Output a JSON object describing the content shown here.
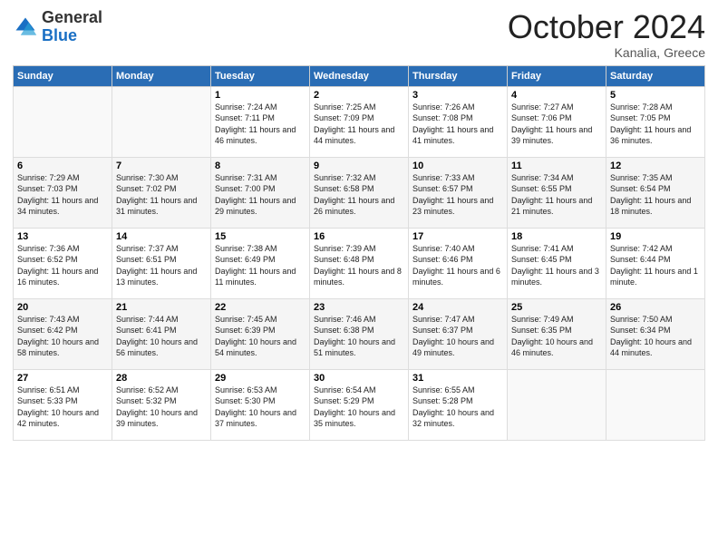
{
  "logo": {
    "general": "General",
    "blue": "Blue"
  },
  "header": {
    "month": "October 2024",
    "location": "Kanalia, Greece"
  },
  "weekdays": [
    "Sunday",
    "Monday",
    "Tuesday",
    "Wednesday",
    "Thursday",
    "Friday",
    "Saturday"
  ],
  "weeks": [
    [
      {
        "day": "",
        "sunrise": "",
        "sunset": "",
        "daylight": ""
      },
      {
        "day": "",
        "sunrise": "",
        "sunset": "",
        "daylight": ""
      },
      {
        "day": "1",
        "sunrise": "Sunrise: 7:24 AM",
        "sunset": "Sunset: 7:11 PM",
        "daylight": "Daylight: 11 hours and 46 minutes."
      },
      {
        "day": "2",
        "sunrise": "Sunrise: 7:25 AM",
        "sunset": "Sunset: 7:09 PM",
        "daylight": "Daylight: 11 hours and 44 minutes."
      },
      {
        "day": "3",
        "sunrise": "Sunrise: 7:26 AM",
        "sunset": "Sunset: 7:08 PM",
        "daylight": "Daylight: 11 hours and 41 minutes."
      },
      {
        "day": "4",
        "sunrise": "Sunrise: 7:27 AM",
        "sunset": "Sunset: 7:06 PM",
        "daylight": "Daylight: 11 hours and 39 minutes."
      },
      {
        "day": "5",
        "sunrise": "Sunrise: 7:28 AM",
        "sunset": "Sunset: 7:05 PM",
        "daylight": "Daylight: 11 hours and 36 minutes."
      }
    ],
    [
      {
        "day": "6",
        "sunrise": "Sunrise: 7:29 AM",
        "sunset": "Sunset: 7:03 PM",
        "daylight": "Daylight: 11 hours and 34 minutes."
      },
      {
        "day": "7",
        "sunrise": "Sunrise: 7:30 AM",
        "sunset": "Sunset: 7:02 PM",
        "daylight": "Daylight: 11 hours and 31 minutes."
      },
      {
        "day": "8",
        "sunrise": "Sunrise: 7:31 AM",
        "sunset": "Sunset: 7:00 PM",
        "daylight": "Daylight: 11 hours and 29 minutes."
      },
      {
        "day": "9",
        "sunrise": "Sunrise: 7:32 AM",
        "sunset": "Sunset: 6:58 PM",
        "daylight": "Daylight: 11 hours and 26 minutes."
      },
      {
        "day": "10",
        "sunrise": "Sunrise: 7:33 AM",
        "sunset": "Sunset: 6:57 PM",
        "daylight": "Daylight: 11 hours and 23 minutes."
      },
      {
        "day": "11",
        "sunrise": "Sunrise: 7:34 AM",
        "sunset": "Sunset: 6:55 PM",
        "daylight": "Daylight: 11 hours and 21 minutes."
      },
      {
        "day": "12",
        "sunrise": "Sunrise: 7:35 AM",
        "sunset": "Sunset: 6:54 PM",
        "daylight": "Daylight: 11 hours and 18 minutes."
      }
    ],
    [
      {
        "day": "13",
        "sunrise": "Sunrise: 7:36 AM",
        "sunset": "Sunset: 6:52 PM",
        "daylight": "Daylight: 11 hours and 16 minutes."
      },
      {
        "day": "14",
        "sunrise": "Sunrise: 7:37 AM",
        "sunset": "Sunset: 6:51 PM",
        "daylight": "Daylight: 11 hours and 13 minutes."
      },
      {
        "day": "15",
        "sunrise": "Sunrise: 7:38 AM",
        "sunset": "Sunset: 6:49 PM",
        "daylight": "Daylight: 11 hours and 11 minutes."
      },
      {
        "day": "16",
        "sunrise": "Sunrise: 7:39 AM",
        "sunset": "Sunset: 6:48 PM",
        "daylight": "Daylight: 11 hours and 8 minutes."
      },
      {
        "day": "17",
        "sunrise": "Sunrise: 7:40 AM",
        "sunset": "Sunset: 6:46 PM",
        "daylight": "Daylight: 11 hours and 6 minutes."
      },
      {
        "day": "18",
        "sunrise": "Sunrise: 7:41 AM",
        "sunset": "Sunset: 6:45 PM",
        "daylight": "Daylight: 11 hours and 3 minutes."
      },
      {
        "day": "19",
        "sunrise": "Sunrise: 7:42 AM",
        "sunset": "Sunset: 6:44 PM",
        "daylight": "Daylight: 11 hours and 1 minute."
      }
    ],
    [
      {
        "day": "20",
        "sunrise": "Sunrise: 7:43 AM",
        "sunset": "Sunset: 6:42 PM",
        "daylight": "Daylight: 10 hours and 58 minutes."
      },
      {
        "day": "21",
        "sunrise": "Sunrise: 7:44 AM",
        "sunset": "Sunset: 6:41 PM",
        "daylight": "Daylight: 10 hours and 56 minutes."
      },
      {
        "day": "22",
        "sunrise": "Sunrise: 7:45 AM",
        "sunset": "Sunset: 6:39 PM",
        "daylight": "Daylight: 10 hours and 54 minutes."
      },
      {
        "day": "23",
        "sunrise": "Sunrise: 7:46 AM",
        "sunset": "Sunset: 6:38 PM",
        "daylight": "Daylight: 10 hours and 51 minutes."
      },
      {
        "day": "24",
        "sunrise": "Sunrise: 7:47 AM",
        "sunset": "Sunset: 6:37 PM",
        "daylight": "Daylight: 10 hours and 49 minutes."
      },
      {
        "day": "25",
        "sunrise": "Sunrise: 7:49 AM",
        "sunset": "Sunset: 6:35 PM",
        "daylight": "Daylight: 10 hours and 46 minutes."
      },
      {
        "day": "26",
        "sunrise": "Sunrise: 7:50 AM",
        "sunset": "Sunset: 6:34 PM",
        "daylight": "Daylight: 10 hours and 44 minutes."
      }
    ],
    [
      {
        "day": "27",
        "sunrise": "Sunrise: 6:51 AM",
        "sunset": "Sunset: 5:33 PM",
        "daylight": "Daylight: 10 hours and 42 minutes."
      },
      {
        "day": "28",
        "sunrise": "Sunrise: 6:52 AM",
        "sunset": "Sunset: 5:32 PM",
        "daylight": "Daylight: 10 hours and 39 minutes."
      },
      {
        "day": "29",
        "sunrise": "Sunrise: 6:53 AM",
        "sunset": "Sunset: 5:30 PM",
        "daylight": "Daylight: 10 hours and 37 minutes."
      },
      {
        "day": "30",
        "sunrise": "Sunrise: 6:54 AM",
        "sunset": "Sunset: 5:29 PM",
        "daylight": "Daylight: 10 hours and 35 minutes."
      },
      {
        "day": "31",
        "sunrise": "Sunrise: 6:55 AM",
        "sunset": "Sunset: 5:28 PM",
        "daylight": "Daylight: 10 hours and 32 minutes."
      },
      {
        "day": "",
        "sunrise": "",
        "sunset": "",
        "daylight": ""
      },
      {
        "day": "",
        "sunrise": "",
        "sunset": "",
        "daylight": ""
      }
    ]
  ]
}
